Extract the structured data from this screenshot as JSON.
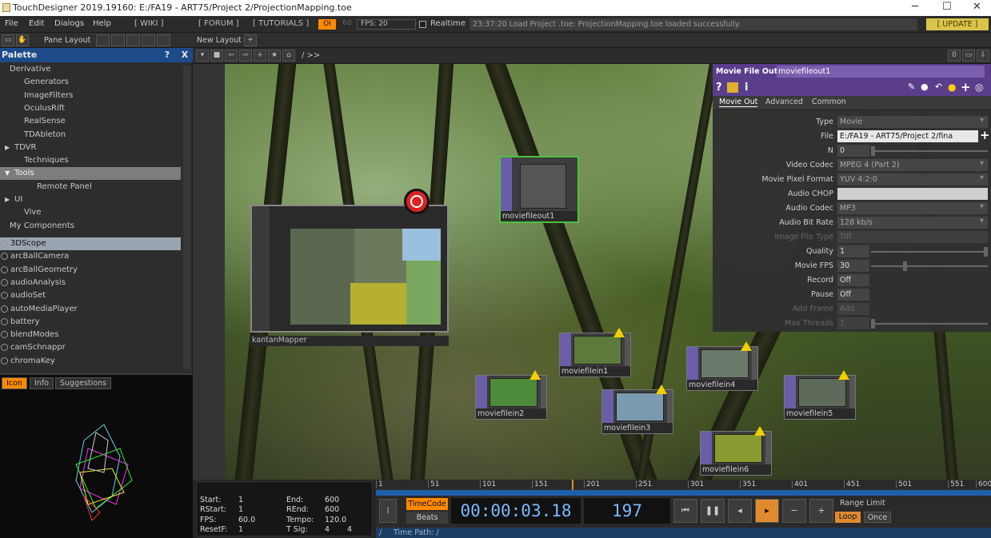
{
  "titlebar": {
    "title": "TouchDesigner 2019.19160: E:/FA19 - ART75/Project 2/ProjectionMapping.toe",
    "min": "─",
    "max": "☐",
    "close": "✕"
  },
  "menu": {
    "file": "File",
    "edit": "Edit",
    "dialogs": "Dialogs",
    "help": "Help",
    "wiki": "[ WIKI ]",
    "forum": "[ FORUM ]",
    "tutorials": "[ TUTORIALS ]",
    "oi": "OI",
    "b60": "60",
    "fps": "FPS:  20",
    "realtime": "Realtime",
    "log": "23:37:20 Load Project .toe: ProjectionMapping.toe loaded successfully.",
    "update": "[ UPDATE ]"
  },
  "toolbar": {
    "pane_layout": "Pane Layout",
    "new_layout": "New Layout",
    "plus": "+"
  },
  "palette": {
    "title": "Palette",
    "help": "?",
    "close": "X",
    "tree": [
      {
        "label": "Derivative",
        "arrow": "▼"
      },
      {
        "label": "Generators",
        "arrow": ""
      },
      {
        "label": "ImageFilters",
        "arrow": ""
      },
      {
        "label": "OculusRift",
        "arrow": ""
      },
      {
        "label": "RealSense",
        "arrow": ""
      },
      {
        "label": "TDAbleton",
        "arrow": ""
      },
      {
        "label": "TDVR",
        "arrow": "▶"
      },
      {
        "label": "Techniques",
        "arrow": ""
      },
      {
        "label": "Tools",
        "arrow": "▼"
      },
      {
        "label": "Remote Panel",
        "arrow": ""
      },
      {
        "label": "UI",
        "arrow": "▶"
      },
      {
        "label": "Vive",
        "arrow": ""
      },
      {
        "label": "My Components",
        "arrow": ""
      }
    ],
    "components": [
      "3DScope",
      "arcBallCamera",
      "arcBallGeometry",
      "audioAnalysis",
      "audioSet",
      "autoMediaPlayer",
      "battery",
      "blendModes",
      "camSchnappr",
      "chromaKey"
    ]
  },
  "iconpanel": {
    "tabs": [
      "Icon",
      "Info",
      "Suggestions"
    ]
  },
  "network": {
    "path": "/ >>",
    "ops": [
      "kantanMapper",
      "moviefileout1",
      "moviefilein1",
      "moviefilein2",
      "moviefilein3",
      "moviefilein4",
      "moviefilein5",
      "moviefilein6"
    ]
  },
  "params": {
    "optype": "Movie File Out",
    "opname": "moviefileout1",
    "tabs": [
      "Movie Out",
      "Advanced",
      "Common"
    ],
    "rows": [
      {
        "label": "Type",
        "value": "Movie",
        "kind": "menu"
      },
      {
        "label": "File",
        "value": "E:/FA19 - ART75/Project 2/fina",
        "kind": "text"
      },
      {
        "label": "N",
        "value": "0",
        "kind": "num"
      },
      {
        "label": "Video Codec",
        "value": "MPEG 4 (Part 2)",
        "kind": "menu"
      },
      {
        "label": "Movie Pixel Format",
        "value": "YUV 4:2:0",
        "kind": "menu"
      },
      {
        "label": "Audio CHOP",
        "value": "",
        "kind": "text"
      },
      {
        "label": "Audio Codec",
        "value": "MP3",
        "kind": "menu"
      },
      {
        "label": "Audio Bit Rate",
        "value": "128 kb/s",
        "kind": "menu"
      },
      {
        "label": "Image File Type",
        "value": "Tiff",
        "kind": "dim"
      },
      {
        "label": "Quality",
        "value": "1",
        "kind": "num"
      },
      {
        "label": "Movie FPS",
        "value": "30",
        "kind": "num"
      },
      {
        "label": "Record",
        "value": "Off",
        "kind": "toggle"
      },
      {
        "label": "Pause",
        "value": "Off",
        "kind": "toggle"
      },
      {
        "label": "Add Frame",
        "value": "Add",
        "kind": "dimbtn"
      },
      {
        "label": "Max Threads",
        "value": "1",
        "kind": "dimnum"
      }
    ]
  },
  "timeline": {
    "start_l": "Start:",
    "start_v": "1",
    "end_l": "End:",
    "end_v": "600",
    "rstart_l": "RStart:",
    "rstart_v": "1",
    "rend_l": "REnd:",
    "rend_v": "600",
    "fps_l": "FPS:",
    "fps_v": "60.0",
    "tempo_l": "Tempo:",
    "tempo_v": "120.0",
    "resetf_l": "ResetF:",
    "resetf_v": "1",
    "tsig_l": "T Sig:",
    "tsig_a": "4",
    "tsig_b": "4",
    "ticks": [
      "1",
      "51",
      "101",
      "151",
      "201",
      "251",
      "301",
      "351",
      "401",
      "451",
      "501",
      "551",
      "600"
    ],
    "timecode": "TimeCode",
    "beats": "Beats",
    "time": "00:00:03.18",
    "frame": "197",
    "range_limit": "Range Limit",
    "loop": "Loop",
    "once": "Once",
    "time_path": "Time Path: /"
  }
}
